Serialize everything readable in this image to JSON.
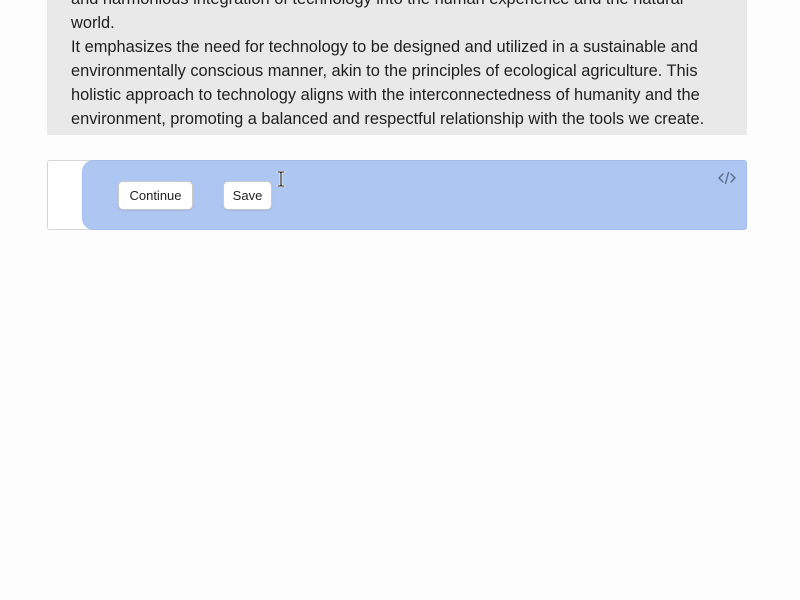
{
  "content": {
    "paragraph_lines": [
      "and harmonious integration of technology into the human experience and the natural world.",
      "It emphasizes the need for technology to be designed and utilized in a sustainable and",
      "environmentally conscious manner, akin to the principles of ecological agriculture. This",
      "holistic approach to technology aligns with the interconnectedness of humanity and the",
      "environment, promoting a balanced and respectful relationship with the tools we create."
    ]
  },
  "block": {
    "continue_label": "Continue",
    "save_label": "Save",
    "code_icon": "code-icon",
    "selected_color": "#aec6f2"
  },
  "cursor": {
    "icon": "text-cursor-icon"
  }
}
